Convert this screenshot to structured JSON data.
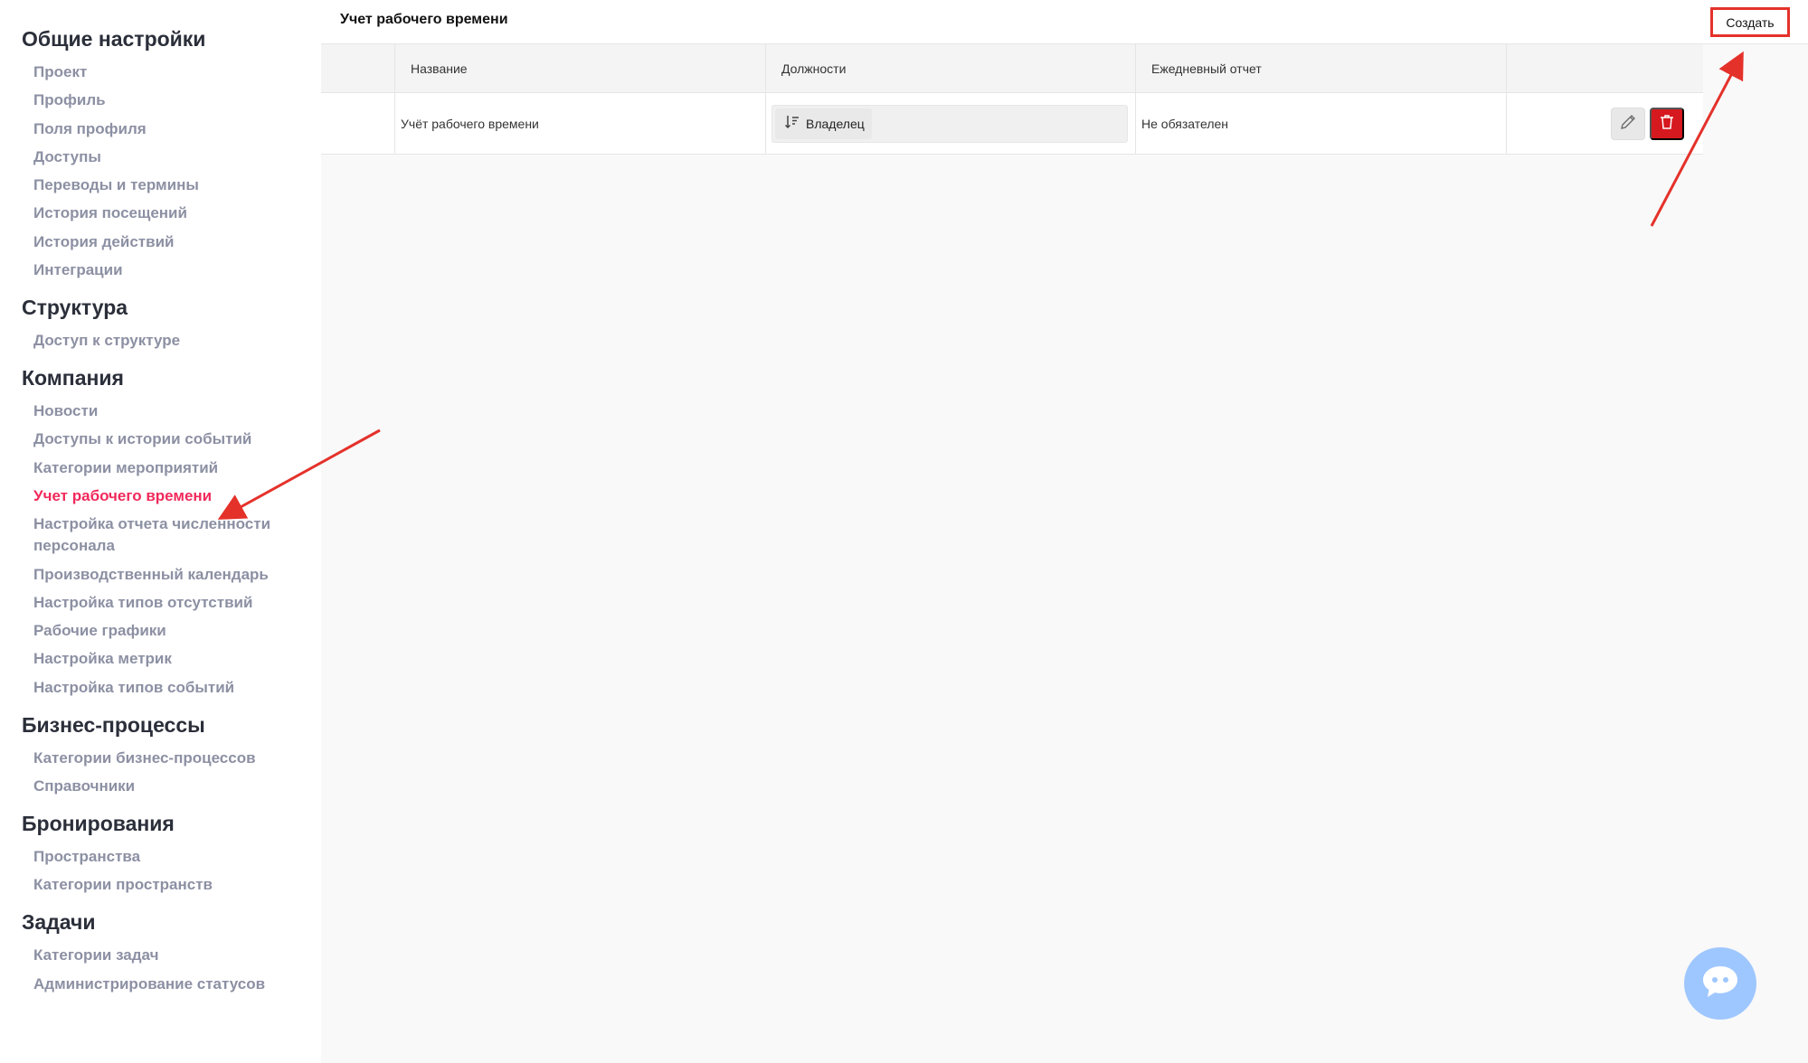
{
  "sidebar": {
    "sections": [
      {
        "title": "Общие настройки",
        "items": [
          "Проект",
          "Профиль",
          "Поля профиля",
          "Доступы",
          "Переводы и термины",
          "История посещений",
          "История действий",
          "Интеграции"
        ]
      },
      {
        "title": "Структура",
        "items": [
          "Доступ к структуре"
        ]
      },
      {
        "title": "Компания",
        "items": [
          "Новости",
          "Доступы к истории событий",
          "Категории мероприятий",
          "Учет рабочего времени",
          "Настройка отчета численности персонала",
          "Производственный календарь",
          "Настройка типов отсутствий",
          "Рабочие графики",
          "Настройка метрик",
          "Настройка типов событий"
        ]
      },
      {
        "title": "Бизнес-процессы",
        "items": [
          "Категории бизнес-процессов",
          "Справочники"
        ]
      },
      {
        "title": "Бронирования",
        "items": [
          "Пространства",
          "Категории пространств"
        ]
      },
      {
        "title": "Задачи",
        "items": [
          "Категории задач",
          "Администрирование статусов"
        ]
      }
    ],
    "active_item": "Учет рабочего времени"
  },
  "header": {
    "title": "Учет рабочего времени",
    "create_label": "Создать"
  },
  "table": {
    "columns": [
      "",
      "Название",
      "Должности",
      "Ежедневный отчет",
      ""
    ],
    "rows": [
      {
        "name": "Учёт рабочего времени",
        "position_tag": "Владелец",
        "daily_report": "Не обязателен"
      }
    ]
  },
  "icons": {
    "tag": "sort-descending-icon",
    "edit": "pencil-icon",
    "delete": "trash-icon",
    "chat": "chat-bubble-icon"
  },
  "colors": {
    "active_nav": "#f0295b",
    "delete_button": "#d6191f",
    "annotation": "#e4322b",
    "chat_bubble": "#9fc7ff"
  }
}
